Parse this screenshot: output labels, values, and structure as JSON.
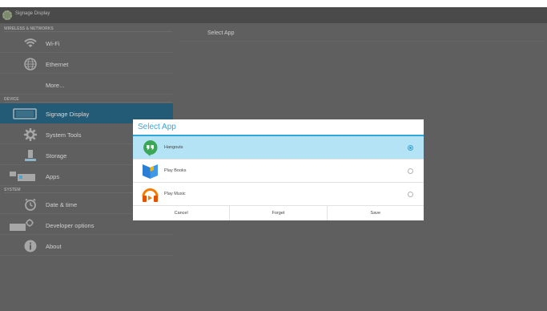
{
  "screen": {
    "app_title": "Signage Display"
  },
  "sections": {
    "wireless": "WIRELESS & NETWORKS",
    "device": "DEVICE",
    "system": "SYSTEM"
  },
  "settings_items": [
    {
      "label": "Wi-Fi",
      "icon": "wifi-icon"
    },
    {
      "label": "Ethernet",
      "icon": "ethernet-icon"
    },
    {
      "label": "More...",
      "icon": ""
    },
    {
      "label": "Signage Display",
      "icon": "display-icon"
    },
    {
      "label": "System Tools",
      "icon": "gear-icon"
    },
    {
      "label": "Storage",
      "icon": "storage-icon"
    },
    {
      "label": "Apps",
      "icon": "apps-icon"
    },
    {
      "label": "Date & time",
      "icon": "clock-icon"
    },
    {
      "label": "Developer options",
      "icon": "developer-icon"
    },
    {
      "label": "About",
      "icon": "info-icon"
    }
  ],
  "right_panel": {
    "title": "Select App"
  },
  "dialog": {
    "title": "Select App",
    "options": [
      {
        "label": "Hangouts",
        "icon": "hangouts-icon",
        "selected": true
      },
      {
        "label": "Play Books",
        "icon": "play-books-icon",
        "selected": false
      },
      {
        "label": "Play Music",
        "icon": "play-music-icon",
        "selected": false
      }
    ],
    "buttons": {
      "cancel": "Cancel",
      "forget": "Forget",
      "save": "Save"
    }
  },
  "colors": {
    "accent": "#33A6D9",
    "active_item": "#235A75",
    "background": "#5F5F5F",
    "selected_row": "#B5E3F6"
  }
}
